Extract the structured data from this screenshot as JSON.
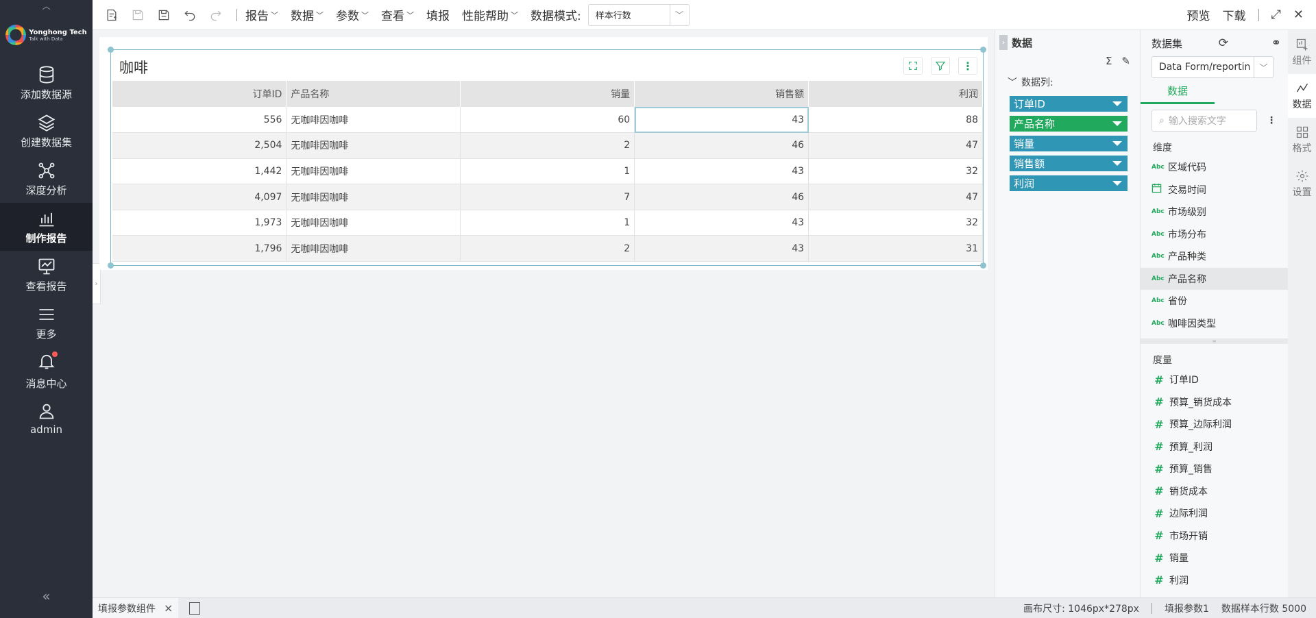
{
  "brand": {
    "name": "Yonghong Tech",
    "slogan": "Talk with Data"
  },
  "leftnav": {
    "items": [
      {
        "label": "添加数据源",
        "icon": "database-icon",
        "active": false
      },
      {
        "label": "创建数据集",
        "icon": "layers-icon",
        "active": false
      },
      {
        "label": "深度分析",
        "icon": "network-icon",
        "active": false
      },
      {
        "label": "制作报告",
        "icon": "bar-chart-icon",
        "active": true
      },
      {
        "label": "查看报告",
        "icon": "monitor-chart-icon",
        "active": false
      },
      {
        "label": "更多",
        "icon": "menu-icon",
        "active": false
      },
      {
        "label": "消息中心",
        "icon": "bell-icon",
        "active": false
      },
      {
        "label": "admin",
        "icon": "user-icon",
        "active": false
      }
    ],
    "collapse_glyph": "«",
    "top_glyph": "︿"
  },
  "toolbar": {
    "menus": [
      "报告",
      "数据",
      "参数",
      "查看",
      "填报",
      "性能帮助"
    ],
    "mode_label": "数据模式:",
    "mode_value": "样本行数",
    "preview": "预览",
    "download": "下载"
  },
  "widget": {
    "title": "咖啡",
    "columns": [
      "订单ID",
      "产品名称",
      "销量",
      "销售额",
      "利润"
    ],
    "rows": [
      [
        "556",
        "无咖啡因咖啡",
        "60",
        "43",
        "88"
      ],
      [
        "2,504",
        "无咖啡因咖啡",
        "2",
        "46",
        "47"
      ],
      [
        "1,442",
        "无咖啡因咖啡",
        "1",
        "43",
        "32"
      ],
      [
        "4,097",
        "无咖啡因咖啡",
        "7",
        "46",
        "47"
      ],
      [
        "1,973",
        "无咖啡因咖啡",
        "1",
        "43",
        "32"
      ],
      [
        "1,796",
        "无咖啡因咖啡",
        "2",
        "43",
        "31"
      ]
    ]
  },
  "datapanel": {
    "title": "数据",
    "section": "数据列:",
    "sigma": "Σ",
    "pills": [
      {
        "label": "订单ID",
        "color": "#2f97b5"
      },
      {
        "label": "产品名称",
        "color": "#21aa5d"
      },
      {
        "label": "销量",
        "color": "#2f97b5"
      },
      {
        "label": "销售额",
        "color": "#2f97b5"
      },
      {
        "label": "利润",
        "color": "#2f97b5"
      }
    ]
  },
  "dataset": {
    "title": "数据集",
    "selected": "Data Form/reportin",
    "tab": "数据",
    "search_placeholder": "输入搜索文字",
    "dim_label": "维度",
    "dimensions": [
      {
        "name": "区域代码",
        "type": "Abc"
      },
      {
        "name": "交易时间",
        "type": "date"
      },
      {
        "name": "市场级别",
        "type": "Abc"
      },
      {
        "name": "市场分布",
        "type": "Abc"
      },
      {
        "name": "产品种类",
        "type": "Abc"
      },
      {
        "name": "产品名称",
        "type": "Abc",
        "highlight": true
      },
      {
        "name": "省份",
        "type": "Abc"
      },
      {
        "name": "咖啡因类型",
        "type": "Abc"
      }
    ],
    "measure_label": "度量",
    "measures": [
      "订单ID",
      "预算_销货成本",
      "预算_边际利润",
      "预算_利润",
      "预算_销售",
      "销货成本",
      "边际利润",
      "市场开销",
      "销量",
      "利润"
    ]
  },
  "rail": [
    {
      "label": "组件",
      "icon": "component-icon",
      "active": false
    },
    {
      "label": "数据",
      "icon": "data-line-icon",
      "active": true
    },
    {
      "label": "格式",
      "icon": "grid-icon",
      "active": false
    },
    {
      "label": "设置",
      "icon": "gear-icon",
      "active": false
    }
  ],
  "statusbar": {
    "tab_label": "填报参数组件",
    "canvas_size": "画布尺寸: 1046px*278px",
    "param": "填报参数1",
    "sample_rows": "数据样本行数 5000"
  },
  "colors": {
    "accent_green": "#21aa5d",
    "pill_blue": "#2f97b5",
    "nav_bg": "#2b2f3a"
  }
}
